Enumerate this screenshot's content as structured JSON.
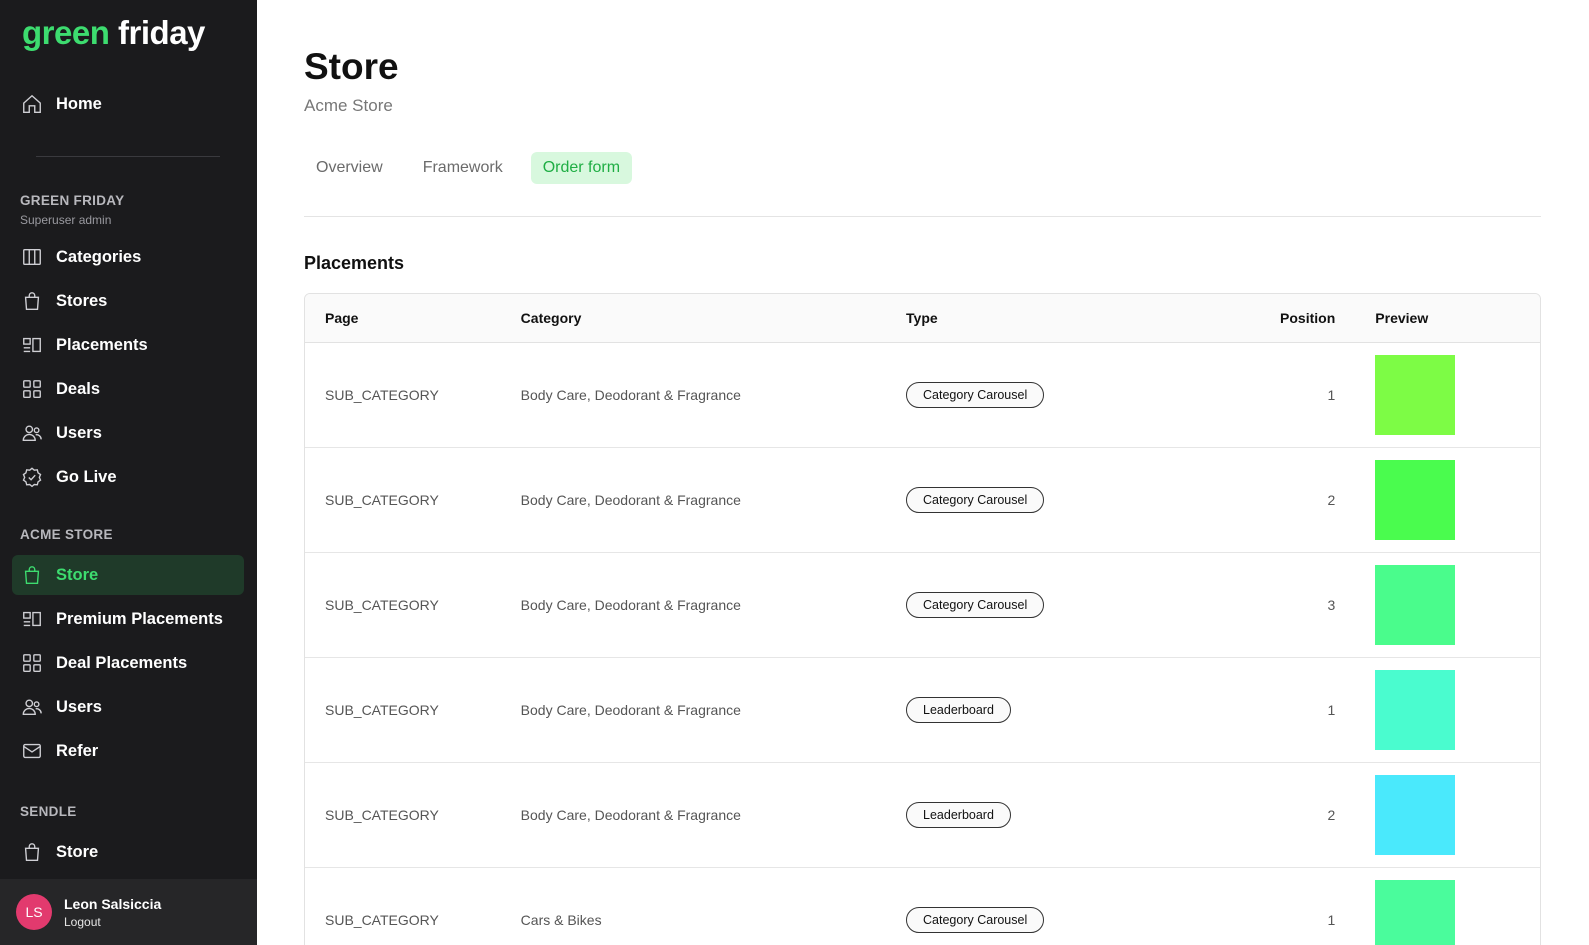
{
  "brand": {
    "part1": "green",
    "part2": "friday"
  },
  "sidebar": {
    "home": "Home",
    "section1": {
      "title": "GREEN FRIDAY",
      "subtitle": "Superuser admin"
    },
    "group1": [
      "Categories",
      "Stores",
      "Placements",
      "Deals",
      "Users",
      "Go Live"
    ],
    "section2": {
      "title": "ACME STORE"
    },
    "group2": [
      "Store",
      "Premium Placements",
      "Deal Placements",
      "Users",
      "Refer"
    ],
    "section3": {
      "title": "SENDLE"
    },
    "group3": [
      "Store"
    ]
  },
  "user": {
    "initials": "LS",
    "name": "Leon Salsiccia",
    "logout": "Logout"
  },
  "page": {
    "title": "Store",
    "subtitle": "Acme Store",
    "tabs": [
      "Overview",
      "Framework",
      "Order form"
    ],
    "section": "Placements"
  },
  "table": {
    "headers": [
      "Page",
      "Category",
      "Type",
      "Position",
      "Preview"
    ],
    "rows": [
      {
        "page": "SUB_CATEGORY",
        "category": "Body Care, Deodorant & Fragrance",
        "type": "Category Carousel",
        "position": "1",
        "color": "#7dfc45"
      },
      {
        "page": "SUB_CATEGORY",
        "category": "Body Care, Deodorant & Fragrance",
        "type": "Category Carousel",
        "position": "2",
        "color": "#4afc4e"
      },
      {
        "page": "SUB_CATEGORY",
        "category": "Body Care, Deodorant & Fragrance",
        "type": "Category Carousel",
        "position": "3",
        "color": "#4afc8c"
      },
      {
        "page": "SUB_CATEGORY",
        "category": "Body Care, Deodorant & Fragrance",
        "type": "Leaderboard",
        "position": "1",
        "color": "#4afccf"
      },
      {
        "page": "SUB_CATEGORY",
        "category": "Body Care, Deodorant & Fragrance",
        "type": "Leaderboard",
        "position": "2",
        "color": "#4ae9fc"
      },
      {
        "page": "SUB_CATEGORY",
        "category": "Cars & Bikes",
        "type": "Category Carousel",
        "position": "1",
        "color": "#4afc9c"
      }
    ]
  },
  "colors": {
    "accent": "#3ddc6f",
    "sidebar_bg": "#1b1b1d",
    "avatar": "#e23a6e"
  }
}
